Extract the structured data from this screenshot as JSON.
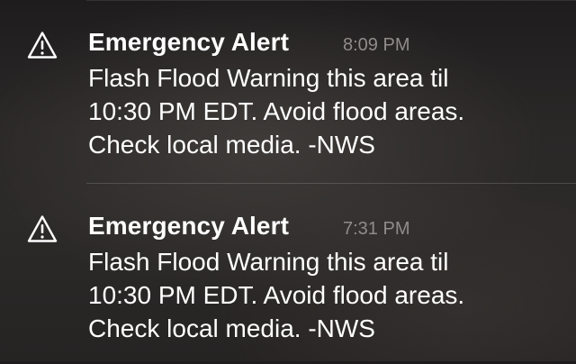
{
  "notifications": [
    {
      "icon": "warning-triangle-icon",
      "title": "Emergency Alert",
      "time": "8:09 PM",
      "body_lines": [
        "Flash Flood Warning this area til",
        "10:30 PM EDT. Avoid flood areas.",
        "Check local media. -NWS"
      ]
    },
    {
      "icon": "warning-triangle-icon",
      "title": "Emergency Alert",
      "time": "7:31 PM",
      "body_lines": [
        "Flash Flood Warning this area til",
        "10:30 PM EDT. Avoid flood areas.",
        "Check local media. -NWS"
      ]
    }
  ],
  "colors": {
    "title": "#ffffff",
    "body": "#ffffff",
    "time": "#8f8c8a",
    "background": "#2a2827"
  }
}
